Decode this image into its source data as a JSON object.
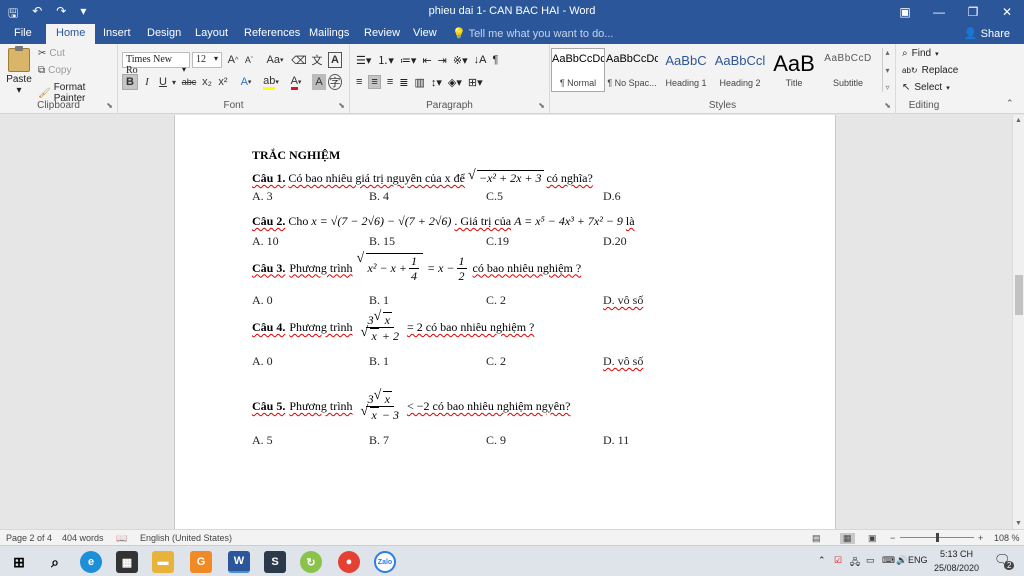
{
  "window": {
    "title": "phieu dai 1- CAN BAC HAI - Word",
    "qat_icons": [
      "save-icon",
      "undo-icon",
      "redo-icon",
      "customize-icon"
    ],
    "controls": {
      "ribbon_display": "▣",
      "minimize": "—",
      "restore": "❐",
      "close": "✕"
    }
  },
  "tabs": [
    "File",
    "Home",
    "Insert",
    "Design",
    "Layout",
    "References",
    "Mailings",
    "Review",
    "View"
  ],
  "active_tab": "Home",
  "tell_me": "Tell me what you want to do...",
  "share": "Share",
  "clipboard": {
    "paste": "Paste",
    "cut": "Cut",
    "copy": "Copy",
    "format_painter": "Format Painter",
    "label": "Clipboard"
  },
  "font": {
    "name": "Times New Ro",
    "size": "12",
    "grow": "A",
    "shrink": "A",
    "case": "Aa",
    "bold": "B",
    "italic": "I",
    "underline": "U",
    "strike": "abc",
    "sub": "x₂",
    "sup": "x²",
    "label": "Font"
  },
  "paragraph": {
    "label": "Paragraph"
  },
  "styles": {
    "label": "Styles",
    "items": [
      {
        "sample": "AaBbCcDc",
        "name": "¶ Normal",
        "kind": "normal",
        "selected": true
      },
      {
        "sample": "AaBbCcDc",
        "name": "¶ No Spac...",
        "kind": "normal",
        "selected": false
      },
      {
        "sample": "AaBbC",
        "name": "Heading 1",
        "kind": "h",
        "selected": false
      },
      {
        "sample": "AaBbCcl",
        "name": "Heading 2",
        "kind": "h",
        "selected": false
      },
      {
        "sample": "AaB",
        "name": "Title",
        "kind": "t",
        "selected": false
      },
      {
        "sample": "AaBbCcD",
        "name": "Subtitle",
        "kind": "sub",
        "selected": false
      }
    ]
  },
  "editing": {
    "find": "Find",
    "replace": "Replace",
    "select": "Select",
    "label": "Editing"
  },
  "document": {
    "heading": "TRẮC NGHIỆM",
    "q1": {
      "label": "Câu 1.",
      "text": "Có bao nhiêu giá trị nguyên của x để",
      "expr": "−x² + 2x + 3",
      "tail": "có nghĩa?",
      "options": [
        "A. 3",
        "B. 4",
        "C.5",
        "D.6"
      ]
    },
    "q2": {
      "label": "Câu 2.",
      "text": "Cho",
      "expr": "x = √(7 − 2√6) − √(7 + 2√6)",
      "mid": ". Giá trị của",
      "expr2": "A = x⁵ − 4x³ + 7x² − 9",
      "tail": "là",
      "options": [
        "A. 10",
        "B. 15",
        "C.19",
        "D.20"
      ]
    },
    "q3": {
      "label": "Câu 3.",
      "text": "Phương trình",
      "tail": "có bao nhiêu nghiệm ?",
      "options": [
        "A. 0",
        "B. 1",
        "C. 2",
        "D. vô số"
      ]
    },
    "q4": {
      "label": "Câu 4.",
      "text": "Phương trình",
      "tail": "= 2 có bao nhiêu nghiệm ?",
      "options": [
        "A. 0",
        "B. 1",
        "C. 2",
        "D. vô số"
      ]
    },
    "q5": {
      "label": "Câu 5.",
      "text": "Phương trình",
      "tail": "< −2 có bao nhiêu nghiệm ngyên?",
      "options": [
        "A. 5",
        "B. 7",
        "C. 9",
        "D. 11"
      ]
    }
  },
  "status": {
    "page": "Page 2 of 4",
    "words": "404 words",
    "language": "English (United States)",
    "zoom": "108 %"
  },
  "taskbar": {
    "time": "5:13 CH",
    "date": "25/08/2020",
    "lang": "ENG",
    "notifications": "2"
  }
}
